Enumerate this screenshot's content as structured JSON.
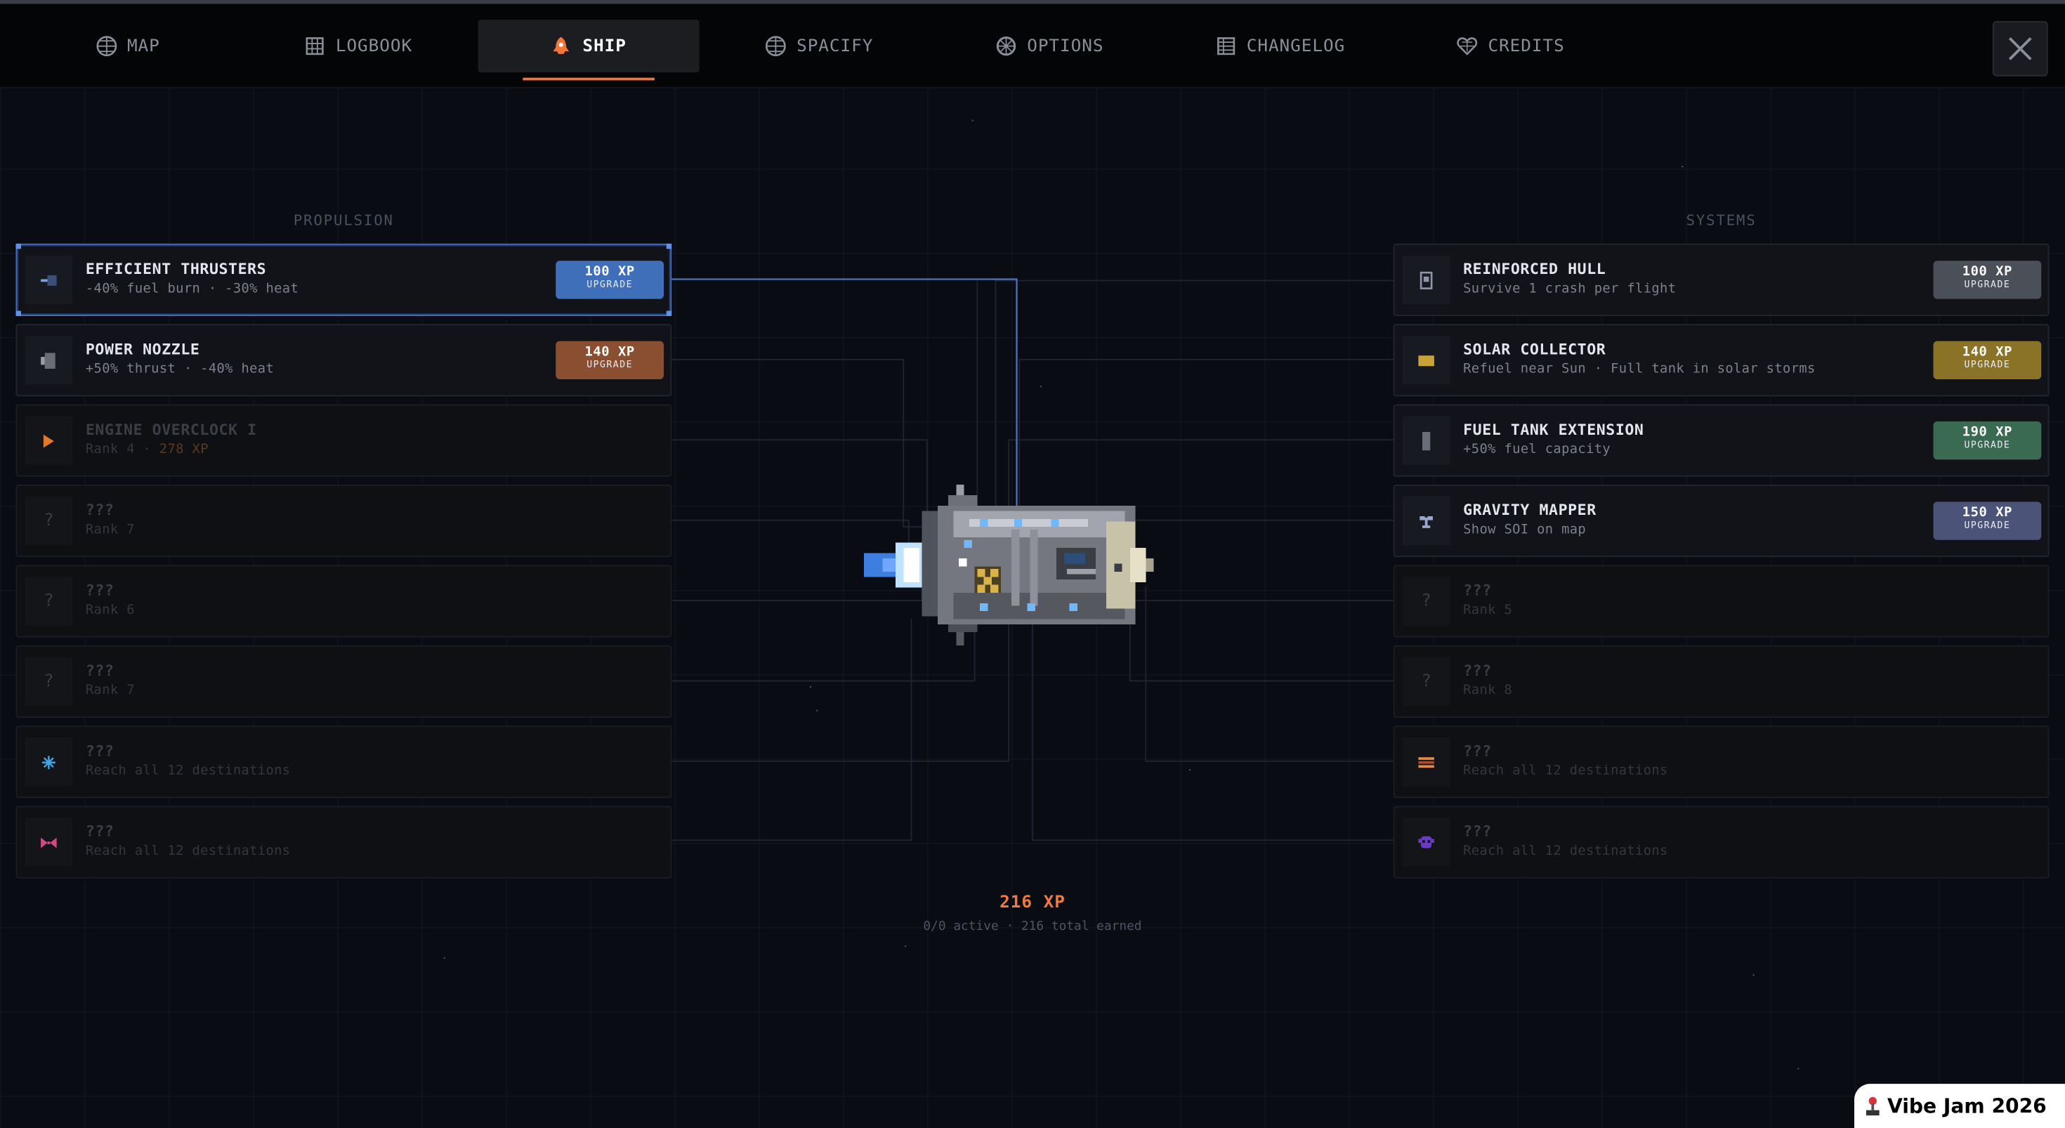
{
  "nav": {
    "tabs": [
      {
        "label": "MAP",
        "icon": "globe-icon"
      },
      {
        "label": "LOGBOOK",
        "icon": "grid-icon"
      },
      {
        "label": "SHIP",
        "icon": "rocket-icon",
        "active": true
      },
      {
        "label": "SPACIFY",
        "icon": "globe-icon"
      },
      {
        "label": "OPTIONS",
        "icon": "gear-icon"
      },
      {
        "label": "CHANGELOG",
        "icon": "list-icon"
      },
      {
        "label": "CREDITS",
        "icon": "heart-icon"
      }
    ],
    "accent": "#f2753a"
  },
  "propulsion": {
    "title": "PROPULSION",
    "items": [
      {
        "title": "EFFICIENT THRUSTERS",
        "subtitle": "-40% fuel burn · -30% heat",
        "xp": "100 XP",
        "btn": "UPGRADE",
        "color": "#3f6fb8"
      },
      {
        "title": "POWER NOZZLE",
        "subtitle": "+50% thrust · -40% heat",
        "xp": "140 XP",
        "btn": "UPGRADE",
        "color": "#8a4e30"
      },
      {
        "title": "ENGINE OVERCLOCK I",
        "subtitle": "Rank 4",
        "cost": "278 XP"
      },
      {
        "title": "???",
        "subtitle": "Rank 7"
      },
      {
        "title": "???",
        "subtitle": "Rank 6"
      },
      {
        "title": "???",
        "subtitle": "Rank 7"
      },
      {
        "title": "???",
        "subtitle": "Reach all 12 destinations"
      },
      {
        "title": "???",
        "subtitle": "Reach all 12 destinations"
      }
    ]
  },
  "systems": {
    "title": "SYSTEMS",
    "items": [
      {
        "title": "REINFORCED HULL",
        "subtitle": "Survive 1 crash per flight",
        "xp": "100 XP",
        "btn": "UPGRADE",
        "color": "#4b4f58"
      },
      {
        "title": "SOLAR COLLECTOR",
        "subtitle": "Refuel near Sun · Full tank in solar storms",
        "xp": "140 XP",
        "btn": "UPGRADE",
        "color": "#8a7326"
      },
      {
        "title": "FUEL TANK EXTENSION",
        "subtitle": "+50% fuel capacity",
        "xp": "190 XP",
        "btn": "UPGRADE",
        "color": "#3b6a52"
      },
      {
        "title": "GRAVITY MAPPER",
        "subtitle": "Show SOI on map",
        "xp": "150 XP",
        "btn": "UPGRADE",
        "color": "#4c5378"
      },
      {
        "title": "???",
        "subtitle": "Rank 5"
      },
      {
        "title": "???",
        "subtitle": "Rank 8"
      },
      {
        "title": "???",
        "subtitle": "Reach all 12 destinations"
      },
      {
        "title": "???",
        "subtitle": "Reach all 12 destinations"
      }
    ]
  },
  "summary": {
    "xp": "216 XP",
    "active": "0/0 active",
    "sep": "·",
    "earned": "216 total earned"
  },
  "badge": {
    "label": "Vibe Jam 2026",
    "icon": "joystick-icon"
  }
}
